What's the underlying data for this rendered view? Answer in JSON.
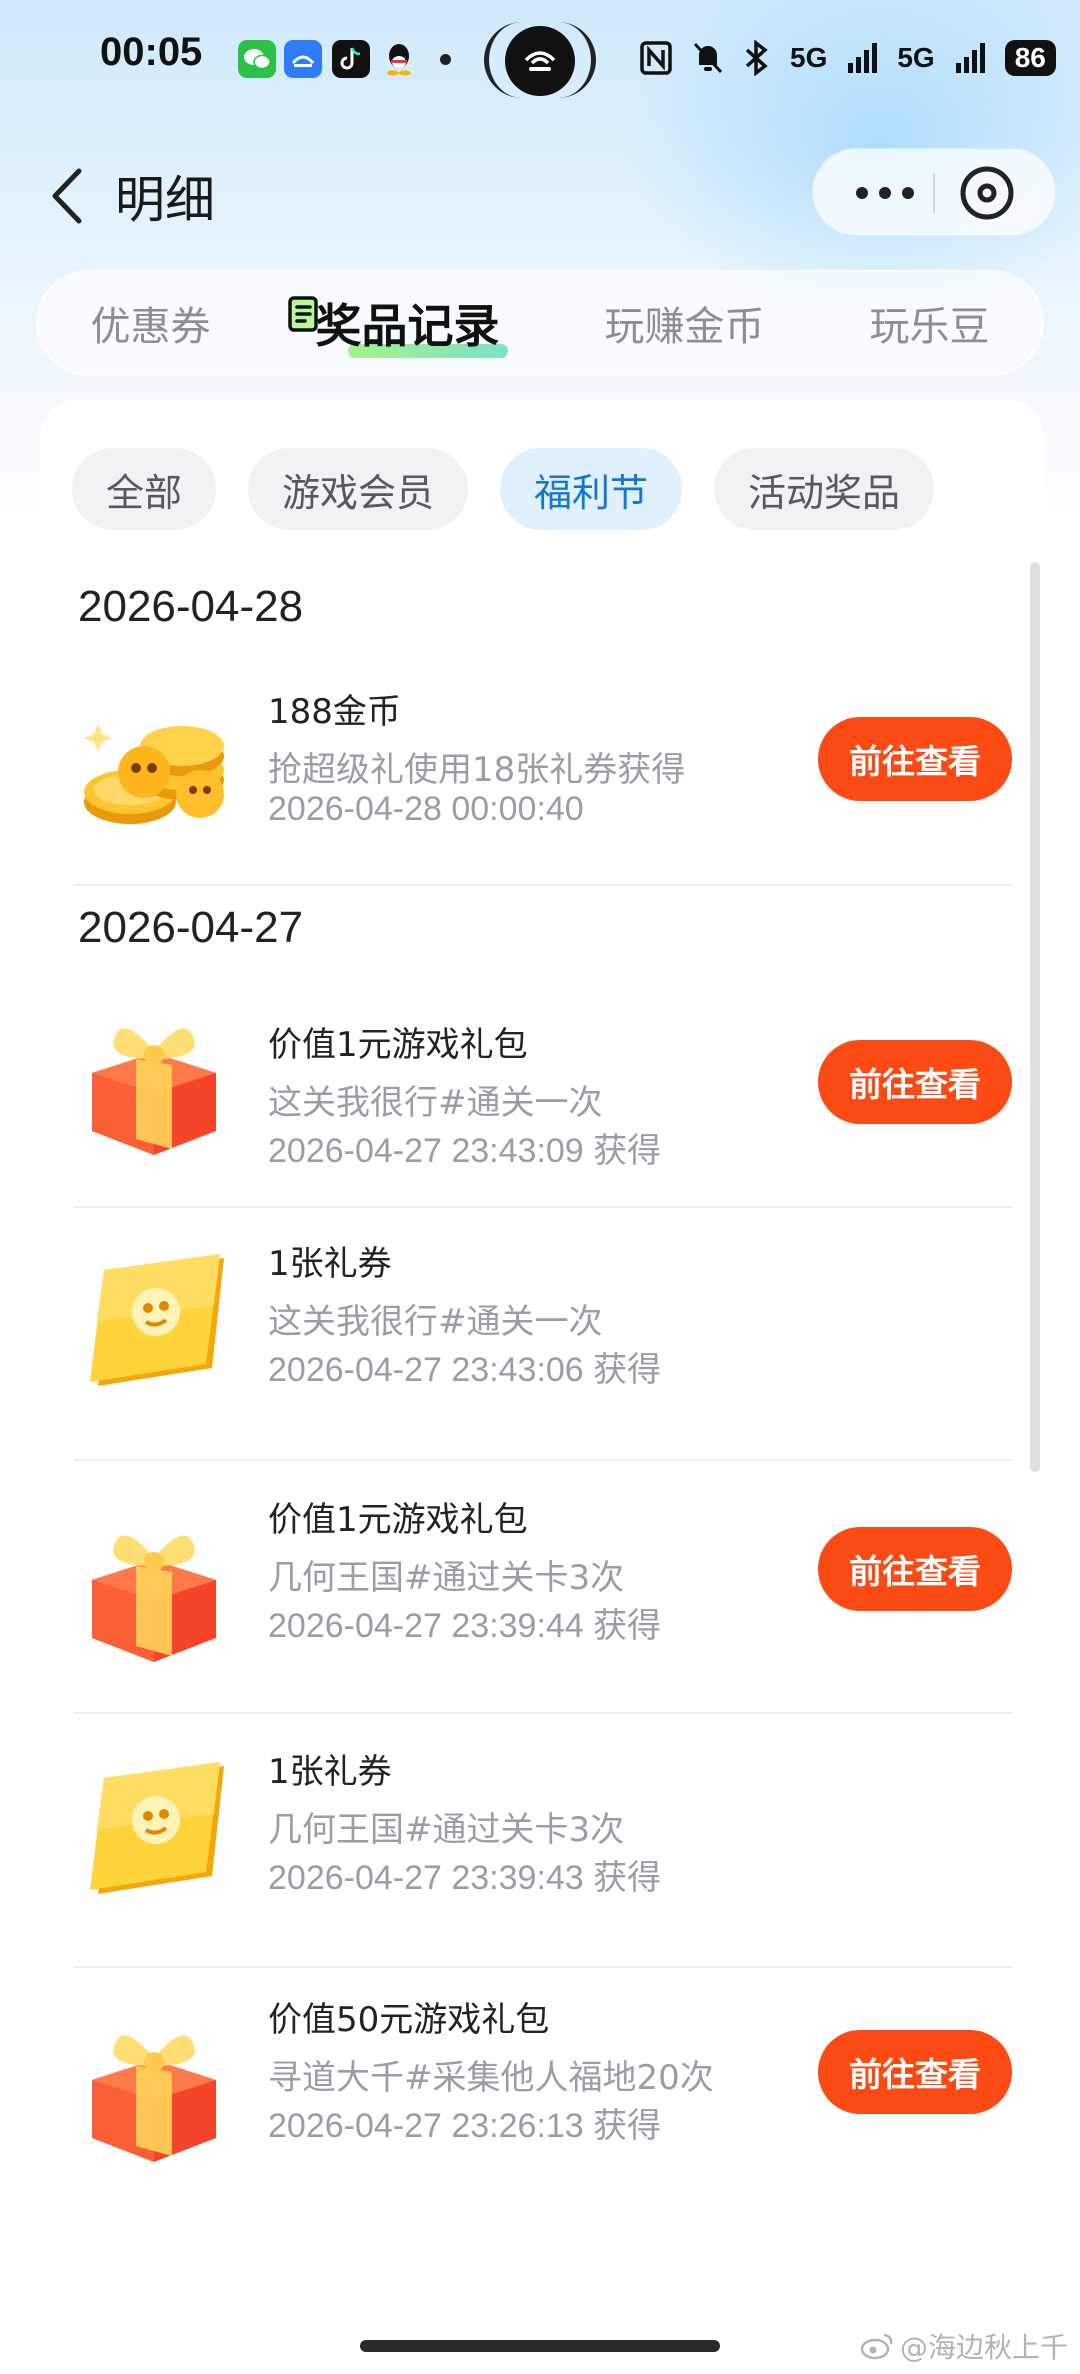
{
  "status_bar": {
    "time": "00:05",
    "network_1": "5G",
    "network_2": "5G",
    "battery": "86"
  },
  "header": {
    "title": "明细"
  },
  "main_tabs": [
    "优惠券",
    "奖品记录",
    "玩赚金币",
    "玩乐豆"
  ],
  "active_main_tab": "奖品记录",
  "filters": [
    "全部",
    "游戏会员",
    "福利节",
    "活动奖品"
  ],
  "active_filter": "福利节",
  "button_label": "前往查看",
  "groups": [
    {
      "date": "2026-04-28"
    },
    {
      "date": "2026-04-27"
    }
  ],
  "records": [
    {
      "name": "188金币",
      "desc": "抢超级礼使用18张礼券获得",
      "time": "2026-04-28 00:00:40",
      "icon": "coins-icon",
      "has_button": true
    },
    {
      "name": "价值1元游戏礼包",
      "desc": "这关我很行#通关一次",
      "time": "2026-04-27 23:43:09 获得",
      "icon": "gift-box-icon",
      "has_button": true
    },
    {
      "name": "1张礼券",
      "desc": "这关我很行#通关一次",
      "time": "2026-04-27 23:43:06 获得",
      "icon": "coupon-ticket-icon",
      "has_button": false
    },
    {
      "name": "价值1元游戏礼包",
      "desc": "几何王国#通过关卡3次",
      "time": "2026-04-27 23:39:44 获得",
      "icon": "gift-box-icon",
      "has_button": true
    },
    {
      "name": "1张礼券",
      "desc": "几何王国#通过关卡3次",
      "time": "2026-04-27 23:39:43 获得",
      "icon": "coupon-ticket-icon",
      "has_button": false
    },
    {
      "name": "价值50元游戏礼包",
      "desc": "寻道大千#采集他人福地20次",
      "time": "2026-04-27 23:26:13 获得",
      "icon": "gift-box-icon",
      "has_button": true
    }
  ],
  "watermark": "@海边秋上千",
  "colors": {
    "accent": "#fc4a14",
    "active_filter_text": "#1677d2",
    "active_filter_bg": "#e0f1fd"
  }
}
